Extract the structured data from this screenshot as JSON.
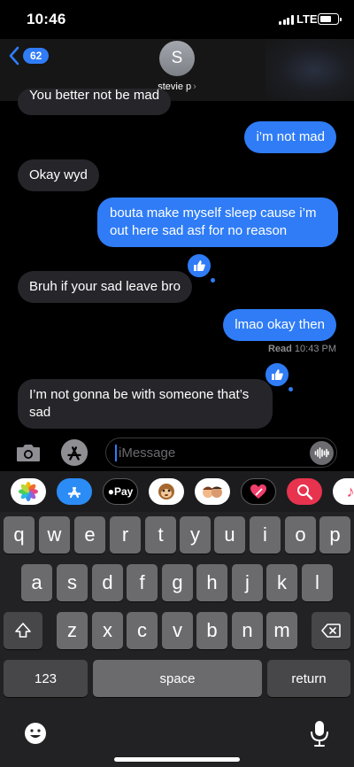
{
  "status": {
    "time": "10:46",
    "network": "LTE"
  },
  "nav": {
    "back_count": "62",
    "avatar_initial": "S",
    "contact_name": "stevie p",
    "chevron": "›"
  },
  "messages": [
    {
      "from": "them",
      "text": "You better not be mad"
    },
    {
      "from": "me",
      "text": "i’m not mad"
    },
    {
      "from": "them",
      "text": "Okay wyd"
    },
    {
      "from": "me",
      "text": "bouta make myself sleep cause i’m out here sad asf for no reason"
    },
    {
      "from": "them",
      "text": "Bruh if your sad leave bro"
    },
    {
      "from": "me",
      "text": "lmao okay then"
    },
    {
      "from": "them",
      "text": "I’m not gonna be with someone that’s sad"
    }
  ],
  "read_receipt": {
    "label": "Read",
    "time": "10:43 PM"
  },
  "tapbacks": [
    {
      "icon": "thumbs-up-icon"
    },
    {
      "icon": "thumbs-up-icon"
    }
  ],
  "composer": {
    "placeholder": "iMessage"
  },
  "app_drawer": [
    {
      "name": "photos-app-icon",
      "label": ""
    },
    {
      "name": "app-store-app-icon",
      "label": ""
    },
    {
      "name": "apple-pay-app-icon",
      "label": "Pay"
    },
    {
      "name": "animoji-app-icon",
      "label": ""
    },
    {
      "name": "memoji-app-icon",
      "label": ""
    },
    {
      "name": "digital-touch-app-icon",
      "label": ""
    },
    {
      "name": "images-search-app-icon",
      "label": ""
    },
    {
      "name": "music-app-icon",
      "label": "♪"
    }
  ],
  "keyboard": {
    "row1": [
      "q",
      "w",
      "e",
      "r",
      "t",
      "y",
      "u",
      "i",
      "o",
      "p"
    ],
    "row2": [
      "a",
      "s",
      "d",
      "f",
      "g",
      "h",
      "j",
      "k",
      "l"
    ],
    "row3": [
      "z",
      "x",
      "c",
      "v",
      "b",
      "n",
      "m"
    ],
    "numbers": "123",
    "space": "space",
    "return": "return"
  },
  "colors": {
    "accent": "#2f7cf6",
    "incoming_bubble": "#26252a",
    "key": "#6b6b6e",
    "key_dark": "#474749"
  }
}
